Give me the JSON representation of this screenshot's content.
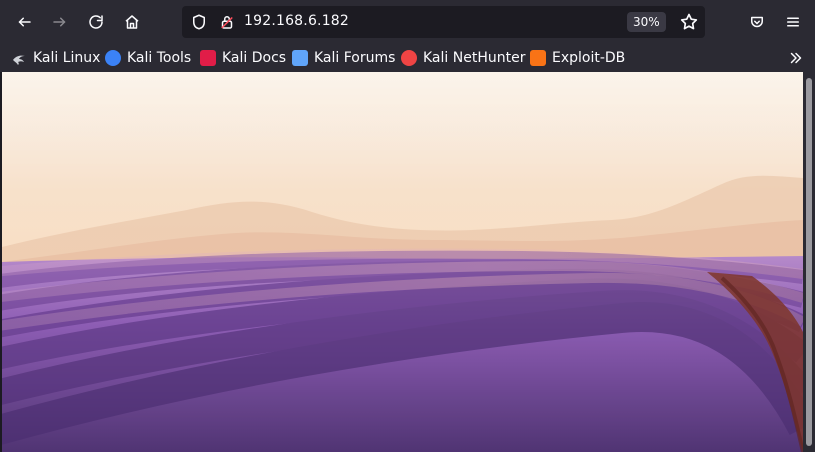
{
  "browser": {
    "url": "192.168.6.182",
    "zoom": "30%",
    "nav": {
      "back": "back-arrow-icon",
      "forward": "forward-arrow-icon",
      "reload": "reload-icon",
      "home": "home-icon"
    },
    "toolbar_right": {
      "pocket": "pocket-icon",
      "menu": "hamburger-menu-icon"
    },
    "bookmarks": [
      {
        "label": "Kali Linux",
        "icon": "kali-dragon-icon",
        "color": "#cfd2d8"
      },
      {
        "label": "Kali Tools",
        "icon": "kali-tools-icon",
        "color": "#3b82f6"
      },
      {
        "label": "Kali Docs",
        "icon": "kali-docs-icon",
        "color": "#e11d48"
      },
      {
        "label": "Kali Forums",
        "icon": "kali-forums-icon",
        "color": "#60a5fa"
      },
      {
        "label": "Kali NetHunter",
        "icon": "kali-nethunter-icon",
        "color": "#ef4444"
      },
      {
        "label": "Exploit-DB",
        "icon": "exploit-db-icon",
        "color": "#f97316"
      }
    ]
  },
  "page": {
    "image_alt": "Lavender field landscape photo",
    "colors": {
      "chrome_bg": "#2b2a33",
      "urlbar_bg": "#1c1b22",
      "text": "#fbfbfe",
      "sky_top": "#f6e6d3",
      "sky_mid": "#f8dcc2",
      "lavender_dark": "#4b2e6f",
      "lavender_mid": "#7a4aa0",
      "lavender_light": "#b487c9",
      "path_brown": "#7a2f25"
    }
  }
}
